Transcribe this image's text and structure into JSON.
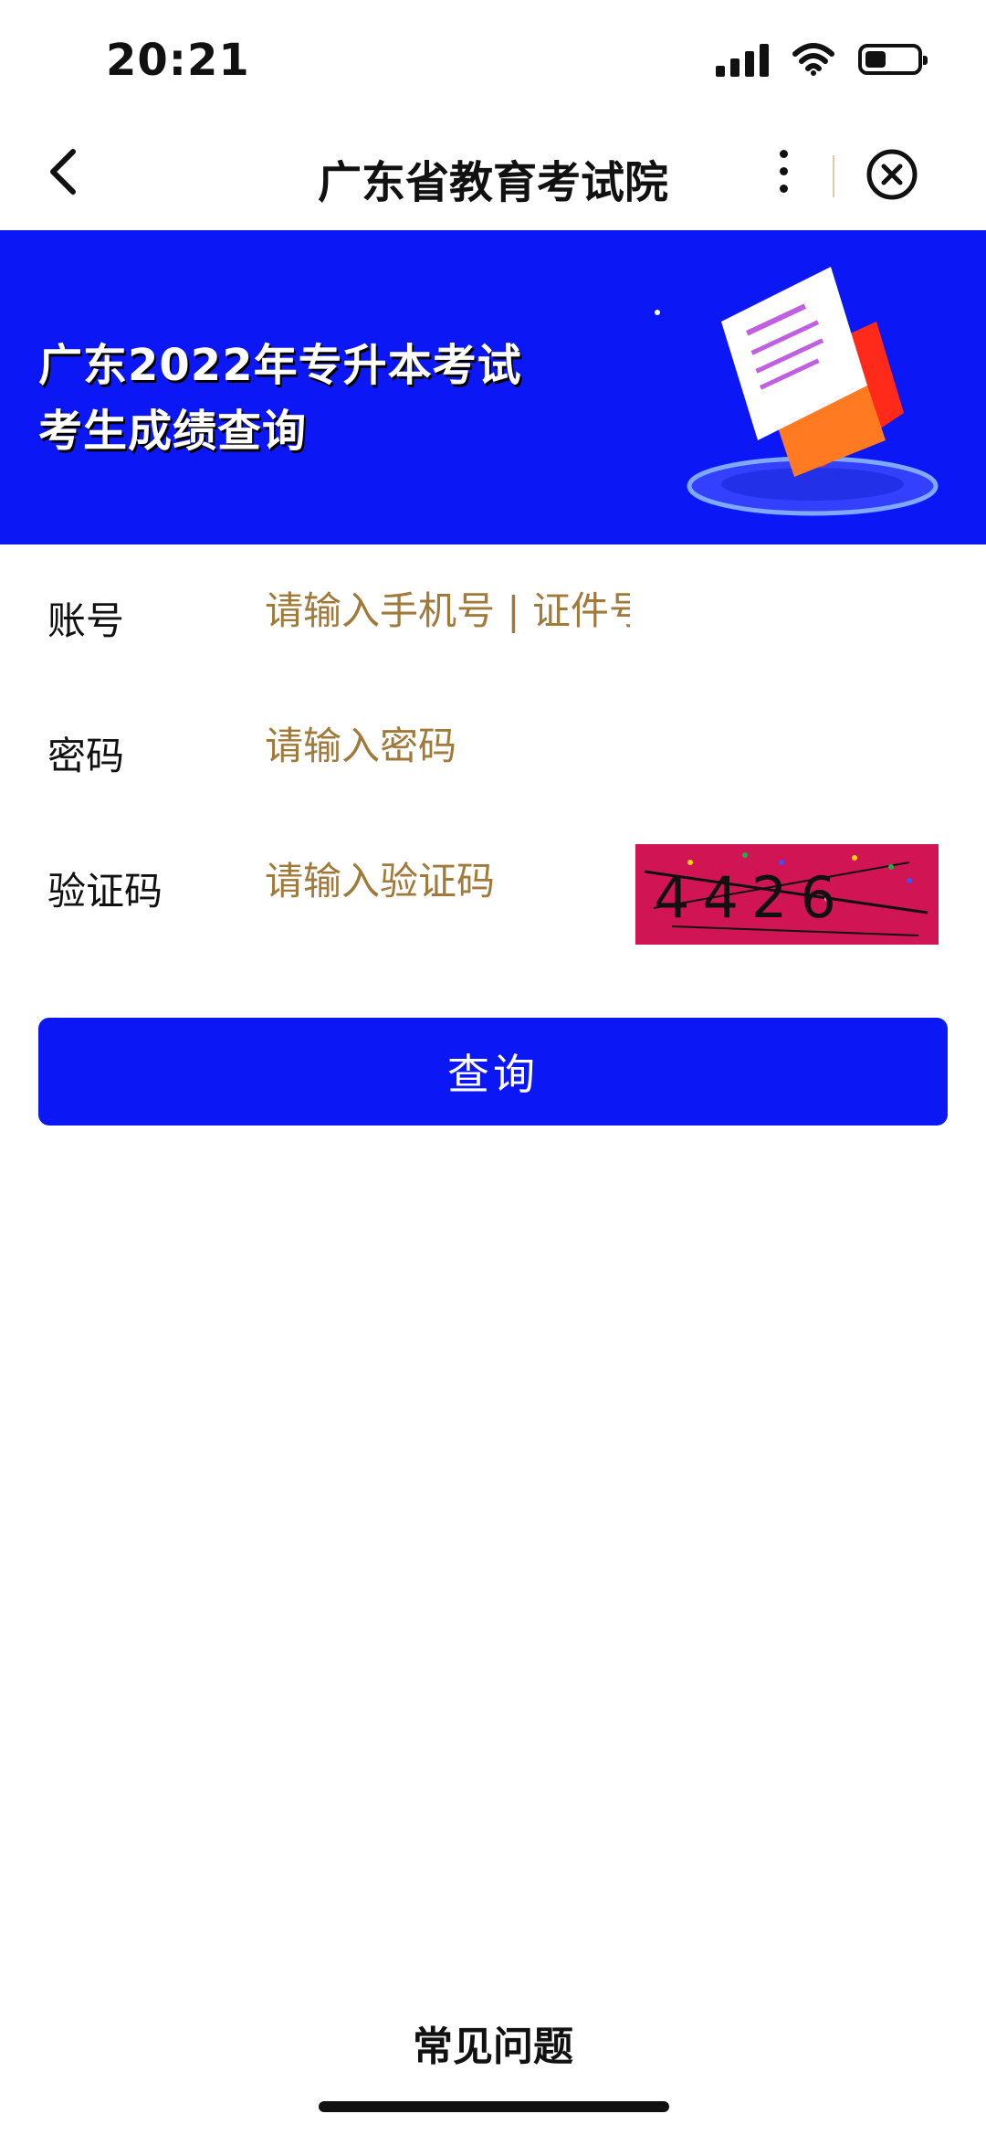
{
  "status_bar": {
    "time": "20:21",
    "battery_level_fraction": 0.4
  },
  "nav": {
    "title": "广东省教育考试院"
  },
  "banner": {
    "line1": "广东2022年专升本考试",
    "line2": "考生成绩查询",
    "background_color": "#0b17f5"
  },
  "form": {
    "account": {
      "label": "账号",
      "placeholder": "请输入手机号 | 证件号"
    },
    "password": {
      "label": "密码",
      "placeholder": "请输入密码"
    },
    "captcha": {
      "label": "验证码",
      "placeholder": "请输入验证码",
      "image_text": "4426"
    },
    "submit_label": "查询"
  },
  "footer": {
    "faq_label": "常见问题"
  },
  "colors": {
    "primary": "#0b17f5",
    "placeholder": "#a07a3a",
    "captcha_bg": "#d11454"
  }
}
